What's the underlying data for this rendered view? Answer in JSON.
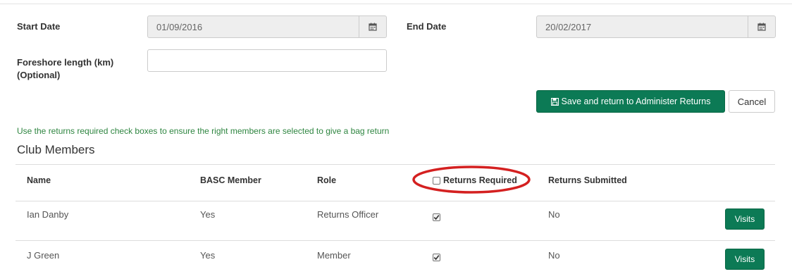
{
  "form": {
    "start_date_label": "Start Date",
    "start_date_value": "01/09/2016",
    "end_date_label": "End Date",
    "end_date_value": "20/02/2017",
    "foreshore_label_line1": "Foreshore length (km)",
    "foreshore_label_line2": "(Optional)",
    "foreshore_value": ""
  },
  "actions": {
    "save_label": "Save and return to Administer Returns",
    "cancel_label": "Cancel"
  },
  "hint": "Use the returns required check boxes to ensure the right members are selected to give a bag return",
  "section_title": "Club Members",
  "table": {
    "headers": {
      "name": "Name",
      "basc": "BASC Member",
      "role": "Role",
      "returns_required": "Returns Required",
      "returns_submitted": "Returns Submitted"
    },
    "rows": [
      {
        "name": "Ian Danby",
        "basc": "Yes",
        "role": "Returns Officer",
        "returns_required": true,
        "returns_submitted": "No",
        "action": "Visits"
      },
      {
        "name": "J Green",
        "basc": "Yes",
        "role": "Member",
        "returns_required": true,
        "returns_submitted": "No",
        "action": "Visits"
      }
    ]
  },
  "colors": {
    "primary_button": "#0c7a55",
    "hint_text": "#2e8540",
    "annotation_circle": "#d42020"
  },
  "icons": [
    "calendar-icon",
    "save-icon",
    "checkbox-icon",
    "checkmark-icon"
  ]
}
